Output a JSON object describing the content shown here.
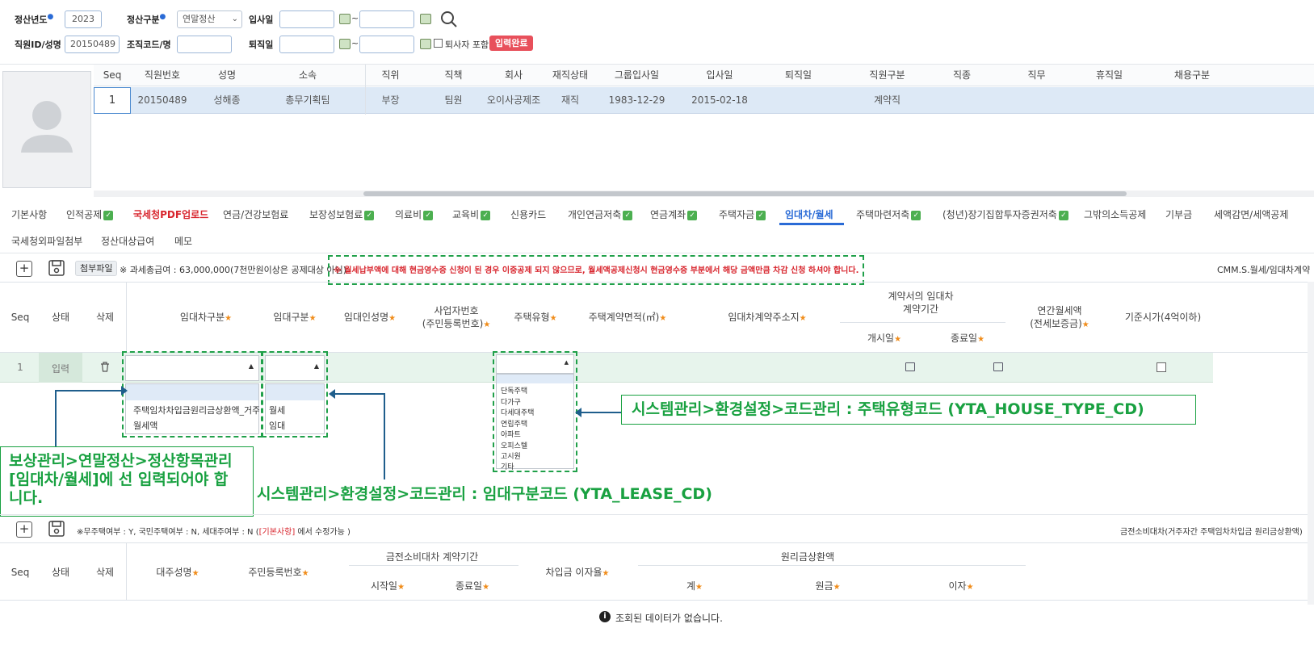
{
  "search": {
    "year_label": "정산년도",
    "year_value": "2023",
    "type_label": "정산구분",
    "type_value": "연말정산",
    "hire_label": "입사일",
    "range_sep": "~",
    "empid_label": "직원ID/성명",
    "empid_value": "20150489",
    "org_label": "조직코드/명",
    "retire_label": "퇴직일",
    "include_retired_label": "퇴사자 포함",
    "status_badge": "입력완료"
  },
  "employee_grid": {
    "columns": [
      "Seq",
      "직원번호",
      "성명",
      "소속",
      "직위",
      "직책",
      "회사",
      "재직상태",
      "그룹입사일",
      "입사일",
      "퇴직일",
      "직원구분",
      "직종",
      "직무",
      "휴직일",
      "채용구분"
    ],
    "row": [
      "1",
      "20150489",
      "성해종",
      "총무기획팀",
      "부장",
      "팀원",
      "오이사공제조",
      "재직",
      "1983-12-29",
      "2015-02-18",
      "",
      "계약직",
      "",
      "",
      "",
      ""
    ]
  },
  "tabs": [
    {
      "label": "기본사항",
      "check": false
    },
    {
      "label": "인적공제",
      "check": true
    },
    {
      "label": "국세청PDF업로드",
      "check": false,
      "red": true
    },
    {
      "label": "연금/건강보험료",
      "check": false
    },
    {
      "label": "보장성보험료",
      "check": true
    },
    {
      "label": "의료비",
      "check": true
    },
    {
      "label": "교육비",
      "check": true
    },
    {
      "label": "신용카드",
      "check": false
    },
    {
      "label": "개인연금저축",
      "check": true
    },
    {
      "label": "연금계좌",
      "check": true
    },
    {
      "label": "주택자금",
      "check": true
    },
    {
      "label": "임대차/월세",
      "check": false,
      "active": true
    },
    {
      "label": "주택마련저축",
      "check": true
    },
    {
      "label": "(청년)장기집합투자증권저축",
      "check": true
    },
    {
      "label": "그밖의소득공제",
      "check": false
    },
    {
      "label": "기부금",
      "check": false
    },
    {
      "label": "세액감면/세액공제",
      "check": false
    },
    {
      "label": "국세청외파일첨부",
      "check": false
    },
    {
      "label": "정산대상급여",
      "check": false
    },
    {
      "label": "메모",
      "check": false
    }
  ],
  "toolbar": {
    "attach_label": "첨부파일",
    "income_note": "※ 과세총급여 : 63,000,000(7천만원이상은 공제대상 아님)",
    "warning_note": "※ 월세납부액에 대해 현금영수증 신청이 된 경우 이중공제 되지 않으므로, 월세액공제신청시 현금영수증 부분에서 해당 금액만큼 차감 신청 하셔야 합니다.",
    "code_right": "CMM.S.월세/임대차계약"
  },
  "rent_grid": {
    "headers": {
      "seq": "Seq",
      "status": "상태",
      "delete": "삭제",
      "lease_type": "임대차구분",
      "lease_kind": "임대구분",
      "lessor": "임대인성명",
      "bizno_1": "사업자번호",
      "bizno_2": "(주민등록번호)",
      "house_type": "주택유형",
      "area": "주택계약면적(㎡)",
      "address": "임대차계약주소지",
      "period_1": "계약서의 임대차",
      "period_2": "계약기간",
      "start": "개시일",
      "end": "종료일",
      "rent_1": "연간월세액",
      "rent_2": "(전세보증금)",
      "base_price": "기준시가(4억이하)"
    },
    "row": {
      "seq": "1",
      "status": "입력"
    },
    "lease_type_options": [
      "",
      "주택임차차입금원리금상환액_거주자",
      "월세액"
    ],
    "lease_kind_options": [
      "",
      "월세",
      "임대"
    ],
    "house_type_options": [
      "",
      "단독주택",
      "다가구",
      "다세대주택",
      "연립주택",
      "아파트",
      "오피스텔",
      "고시원",
      "기타"
    ]
  },
  "annotations": {
    "house_code": "시스템관리>환경설정>코드관리 : 주택유형코드 (YTA_HOUSE_TYPE_CD)",
    "lease_code": "시스템관리>환경설정>코드관리 : 임대구분코드 (YTA_LEASE_CD)",
    "menu_note_1": "보상관리>연말정산>정산항목관리",
    "menu_note_2": "[임대차/월세]에 선 입력되어야 합",
    "menu_note_3": "니다."
  },
  "loan_toolbar": {
    "note_prefix": "※무주택여부 : Y, 국민주택여부 : N, 세대주여부 : N (",
    "note_link": "[기본사항]",
    "note_suffix": " 에서 수정가능 )",
    "right_label": "금전소비대차(거주자간 주택임차차입금 원리금상환액)"
  },
  "loan_grid": {
    "headers": {
      "seq": "Seq",
      "status": "상태",
      "delete": "삭제",
      "lender": "대주성명",
      "rrn": "주민등록번호",
      "period": "금전소비대차 계약기간",
      "start": "시작일",
      "end": "종료일",
      "rate": "차입금 이자율",
      "repay": "원리금상환액",
      "total": "계",
      "principal": "원금",
      "interest": "이자"
    },
    "empty": "조회된 데이터가 없습니다."
  }
}
